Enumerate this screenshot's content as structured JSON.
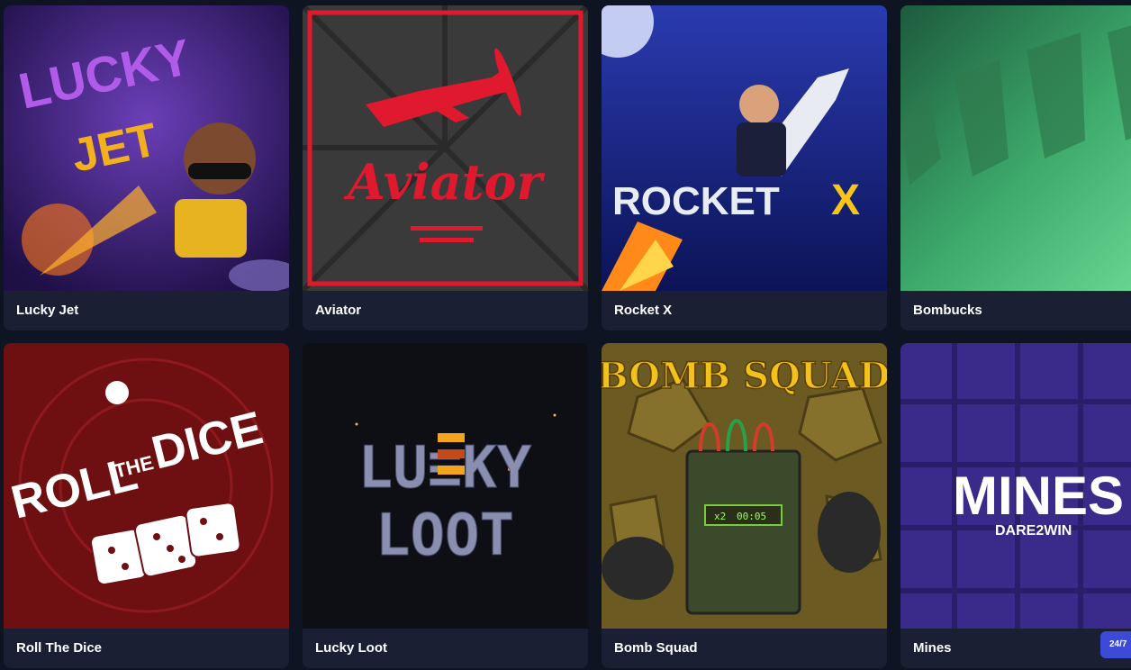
{
  "games": [
    {
      "title": "Lucky Jet",
      "logo_line1": "LUCKY",
      "logo_line2": "JET"
    },
    {
      "title": "Aviator",
      "logo": "Aviator"
    },
    {
      "title": "Rocket X",
      "logo_a": "ROCKET",
      "logo_b": "X"
    },
    {
      "title": "Bombucks"
    },
    {
      "title": "Roll The Dice",
      "logo_a": "ROLL",
      "logo_b": "THE",
      "logo_c": "DICE"
    },
    {
      "title": "Lucky Loot",
      "logo_line1": "LU≡KY",
      "logo_line2": "LOOT"
    },
    {
      "title": "Bomb Squad",
      "logo": "BOMB SQUAD",
      "timer_mult": "x2",
      "timer": "00:05"
    },
    {
      "title": "Mines",
      "logo": "MINES",
      "sub": "DARE2WIN"
    }
  ],
  "chat_badge": "24/7",
  "colors": {
    "background": "#0f1422",
    "card": "#1a1f33",
    "badge": "#3b4bd6"
  }
}
